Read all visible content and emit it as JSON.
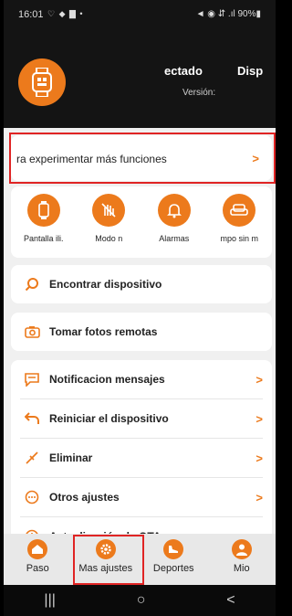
{
  "status_bar": {
    "time": "16:01",
    "left_icons": "♡ ◆ ▇ •",
    "right_icons": "◄ ◉ ⇵ .ıl 90%▮"
  },
  "header": {
    "connection_status": "ectado",
    "device_label": "Disp",
    "version_label": "Versión:"
  },
  "promo": {
    "text": "ra experimentar más funciones",
    "chevron": ">"
  },
  "quick_actions": [
    {
      "label": "Pantalla ili."
    },
    {
      "label": "Modo n"
    },
    {
      "label": "Alarmas"
    },
    {
      "label": "mpo sin m"
    }
  ],
  "find_device": {
    "label": "Encontrar dispositivo"
  },
  "remote_photos": {
    "label": "Tomar fotos remotas"
  },
  "settings": [
    {
      "label": "Notificacion mensajes",
      "chevron": ">"
    },
    {
      "label": "Reiniciar el dispositivo",
      "chevron": ">"
    },
    {
      "label": "Eliminar",
      "chevron": ">"
    },
    {
      "label": "Otros ajustes",
      "chevron": ">"
    },
    {
      "label": "Actualización de OTA",
      "chevron": ">"
    }
  ],
  "bottom_nav": [
    {
      "label": "Paso"
    },
    {
      "label": "Mas ajustes"
    },
    {
      "label": "Deportes"
    },
    {
      "label": "Mio"
    }
  ],
  "system_nav": {
    "recent": "|||",
    "home": "○",
    "back": "<"
  },
  "colors": {
    "accent": "#ec7a1c",
    "highlight": "#e02424",
    "header_bg": "#141414"
  }
}
